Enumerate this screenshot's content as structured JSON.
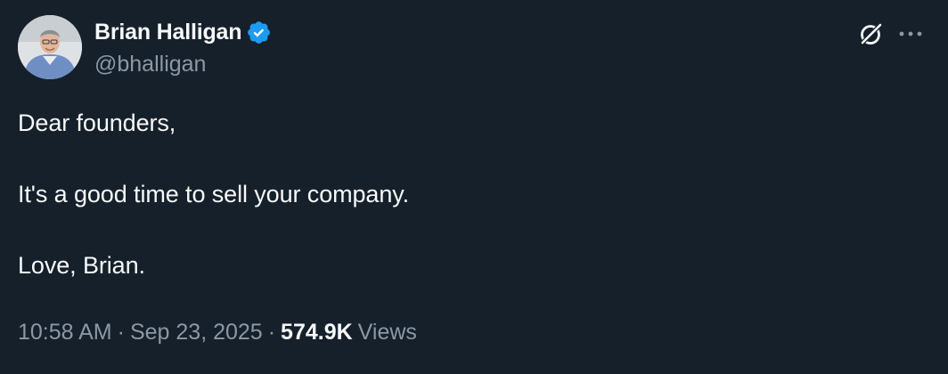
{
  "tweet": {
    "author": {
      "display_name": "Brian Halligan",
      "handle": "@bhalligan",
      "verified": true
    },
    "text_lines": [
      "Dear founders,",
      "It's a good time to sell your company.",
      "Love, Brian."
    ],
    "meta": {
      "time": "10:58 AM",
      "separator": "·",
      "date": "Sep 23, 2025",
      "views_count": "574.9K",
      "views_label": "Views"
    },
    "icons": {
      "grok": "grok-icon",
      "more": "more-icon",
      "verified": "verified-badge-icon"
    }
  },
  "colors": {
    "background": "#15202b",
    "primary_text": "#f7f9f9",
    "secondary_text": "#8b98a5",
    "verified_blue": "#1d9bf0"
  }
}
